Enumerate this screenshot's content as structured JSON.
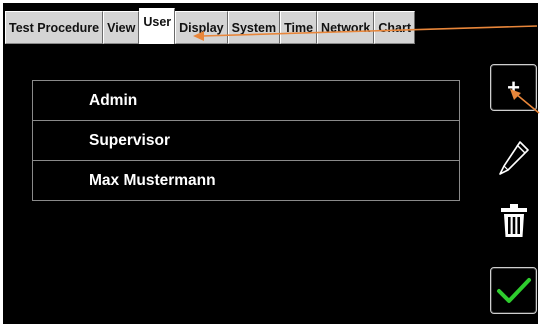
{
  "tabs": [
    {
      "label": "Test Procedure",
      "active": false
    },
    {
      "label": "View",
      "active": false
    },
    {
      "label": "User",
      "active": true
    },
    {
      "label": "Display",
      "active": false
    },
    {
      "label": "System",
      "active": false
    },
    {
      "label": "Time",
      "active": false
    },
    {
      "label": "Network",
      "active": false
    },
    {
      "label": "Chart",
      "active": false
    }
  ],
  "users": [
    "Admin",
    "Supervisor",
    "Max Mustermann"
  ],
  "actions": {
    "add": {
      "label": "+",
      "icon": "plus-icon"
    },
    "edit": {
      "icon": "pencil-icon"
    },
    "delete": {
      "icon": "trash-icon"
    },
    "confirm": {
      "icon": "checkmark-icon"
    }
  },
  "colors": {
    "background": "#000000",
    "tab_background": "#d4d4d4",
    "active_tab": "#ffffff",
    "confirm": "#2ecc2e",
    "annotation_arrow": "#e8863a"
  }
}
